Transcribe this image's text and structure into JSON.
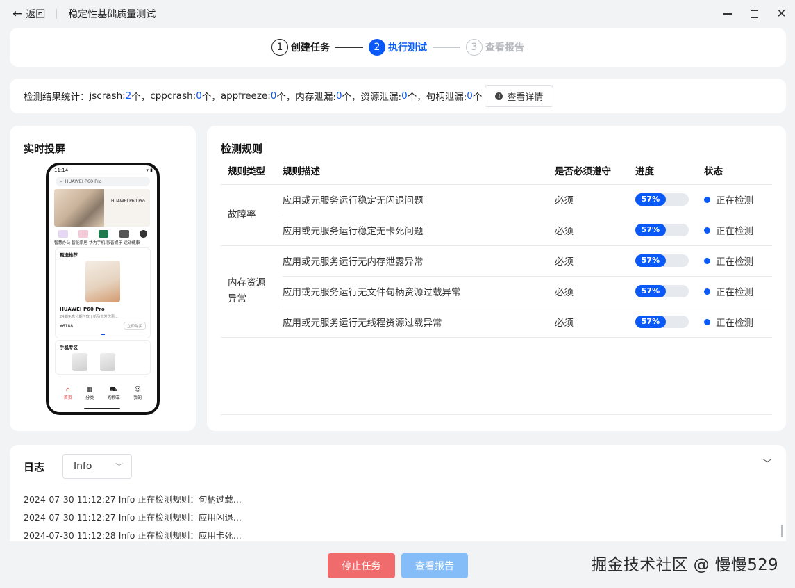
{
  "window": {
    "back_label": "返回",
    "title": "稳定性基础质量测试"
  },
  "stepper": {
    "steps": [
      {
        "num": "1",
        "label": "创建任务",
        "state": "done"
      },
      {
        "num": "2",
        "label": "执行测试",
        "state": "active"
      },
      {
        "num": "3",
        "label": "查看报告",
        "state": "todo"
      }
    ]
  },
  "stats": {
    "prefix": "检测结果统计：",
    "items": [
      {
        "label": "jscrash: ",
        "value": "2",
        "suffix": "个，"
      },
      {
        "label": "cppcrash: ",
        "value": "0",
        "suffix": "个，"
      },
      {
        "label": "appfreeze: ",
        "value": "0",
        "suffix": "个，"
      },
      {
        "label": "内存泄漏: ",
        "value": "0",
        "suffix": "个，"
      },
      {
        "label": "资源泄漏: ",
        "value": "0",
        "suffix": "个，"
      },
      {
        "label": "句柄泄漏: ",
        "value": "0",
        "suffix": "个"
      }
    ],
    "detail_button": "查看详情"
  },
  "screen": {
    "title": "实时投屏",
    "phone": {
      "time": "11:14",
      "search_placeholder": "HUAWEI P60 Pro",
      "banner_text": "HUAWEI P60 Pro",
      "categories": "智慧办公 智能家居 华为手机 影音娱乐 运动健康",
      "section1_title": "甄选推荐",
      "product_name": "HUAWEI P60 Pro",
      "product_sub": "24期免息分期付款 | 新品首发优惠...",
      "product_price": "¥6188",
      "buy_label": "立即购买",
      "section2_title": "手机专区",
      "nav": [
        {
          "icon": "home-icon",
          "label": "首页"
        },
        {
          "icon": "category-icon",
          "label": "分类"
        },
        {
          "icon": "cart-icon",
          "label": "购物车"
        },
        {
          "icon": "user-icon",
          "label": "我的"
        }
      ]
    }
  },
  "rules": {
    "title": "检测规则",
    "headers": [
      "规则类型",
      "规则描述",
      "是否必须遵守",
      "进度",
      "状态"
    ],
    "groups": [
      {
        "type": "故障率",
        "rows": [
          {
            "desc": "应用或元服务运行稳定无闪退问题",
            "required": "必须",
            "progress": 57,
            "progress_label": "57%",
            "status": "正在检测"
          },
          {
            "desc": "应用或元服务运行稳定无卡死问题",
            "required": "必须",
            "progress": 57,
            "progress_label": "57%",
            "status": "正在检测"
          }
        ]
      },
      {
        "type_line1": "内存资源",
        "type_line2": "异常",
        "rows": [
          {
            "desc": "应用或元服务运行无内存泄露异常",
            "required": "必须",
            "progress": 57,
            "progress_label": "57%",
            "status": "正在检测"
          },
          {
            "desc": "应用或元服务运行无文件句柄资源过载异常",
            "required": "必须",
            "progress": 57,
            "progress_label": "57%",
            "status": "正在检测"
          },
          {
            "desc": "应用或元服务运行无线程资源过载异常",
            "required": "必须",
            "progress": 57,
            "progress_label": "57%",
            "status": "正在检测"
          }
        ]
      }
    ]
  },
  "log": {
    "title": "日志",
    "level": "Info",
    "lines": [
      "2024-07-30 11:12:27 Info 正在检测规则：句柄过载...",
      "2024-07-30 11:12:27 Info 正在检测规则：应用闪退...",
      "2024-07-30 11:12:28 Info 正在检测规则：应用卡死..."
    ]
  },
  "footer": {
    "stop_button": "停止任务",
    "report_button": "查看报告"
  },
  "watermark": "掘金技术社区 @ 慢慢529",
  "colors": {
    "accent": "#0a59f7",
    "stop": "#f06c6c",
    "report_disabled": "#85bdf8"
  }
}
